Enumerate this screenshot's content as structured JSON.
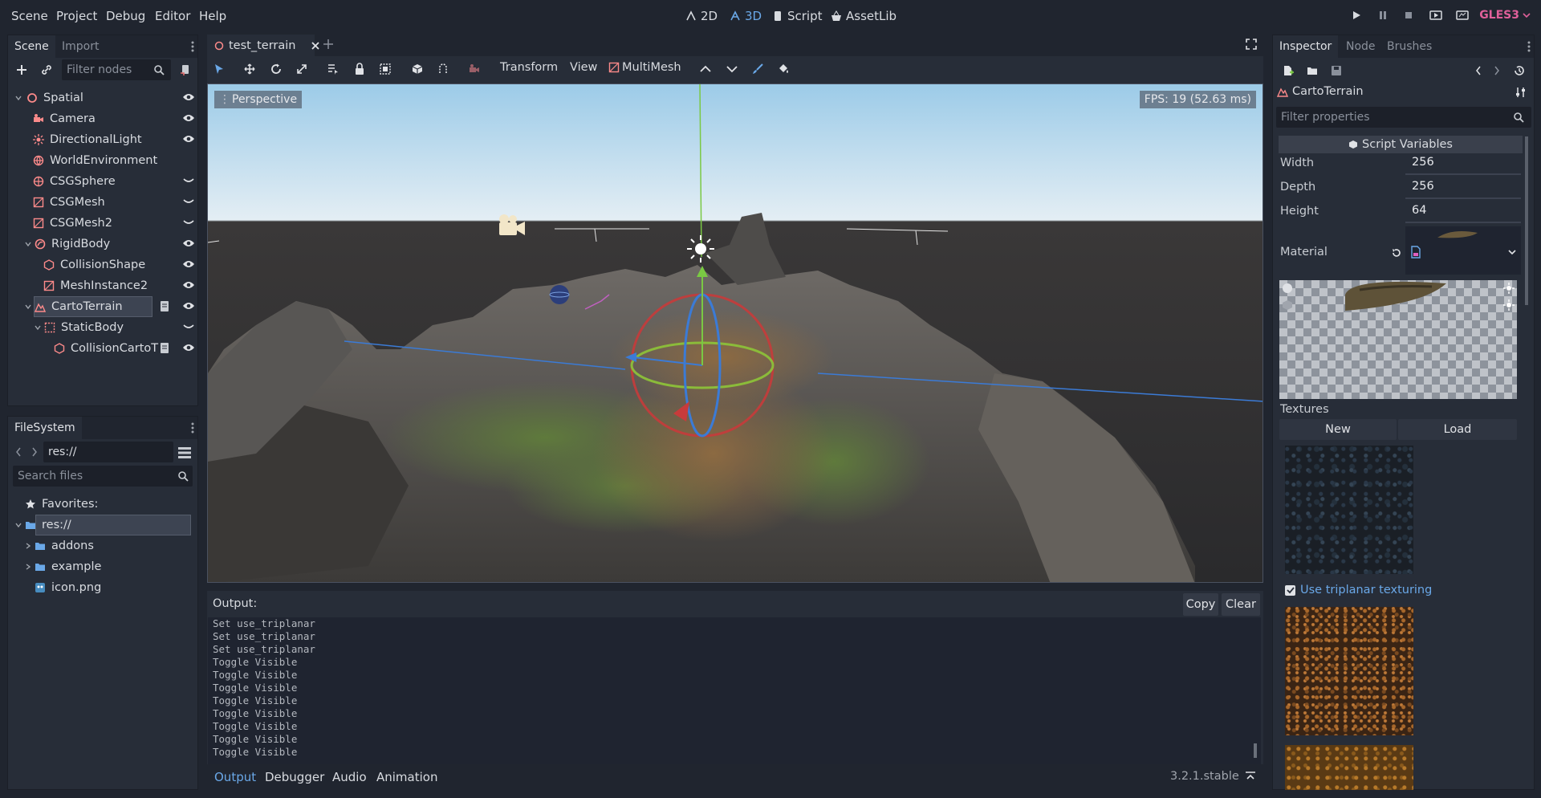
{
  "menu": [
    "Scene",
    "Project",
    "Debug",
    "Editor",
    "Help"
  ],
  "modes": {
    "m2d": "2D",
    "m3d": "3D",
    "script": "Script",
    "assetlib": "AssetLib"
  },
  "renderer": "GLES3",
  "scene_dock": {
    "tabs": {
      "scene": "Scene",
      "import": "Import"
    },
    "filter_placeholder": "Filter nodes",
    "nodes": [
      {
        "label": "Spatial"
      },
      {
        "label": "Camera"
      },
      {
        "label": "DirectionalLight"
      },
      {
        "label": "WorldEnvironment"
      },
      {
        "label": "CSGSphere"
      },
      {
        "label": "CSGMesh"
      },
      {
        "label": "CSGMesh2"
      },
      {
        "label": "RigidBody"
      },
      {
        "label": "CollisionShape"
      },
      {
        "label": "MeshInstance2"
      },
      {
        "label": "CartoTerrain"
      },
      {
        "label": "StaticBody"
      },
      {
        "label": "CollisionCartoT"
      }
    ]
  },
  "filesystem_dock": {
    "tab": "FileSystem",
    "path": "res://",
    "search_placeholder": "Search files",
    "items": [
      {
        "label": "Favorites:"
      },
      {
        "label": "res://"
      },
      {
        "label": "addons"
      },
      {
        "label": "example"
      },
      {
        "label": "icon.png"
      }
    ]
  },
  "editor_tab": "test_terrain",
  "toolbar": {
    "transform": "Transform",
    "view": "View",
    "multimesh": "MultiMesh"
  },
  "viewport": {
    "perspective": "Perspective",
    "fps": "FPS: 19 (52.63 ms)"
  },
  "output": {
    "title": "Output:",
    "copy": "Copy",
    "clear": "Clear",
    "lines": [
      "Set use_triplanar",
      "Set use_triplanar",
      "Set use_triplanar",
      "Toggle Visible",
      "Toggle Visible",
      "Toggle Visible",
      "Toggle Visible",
      "Toggle Visible",
      "Toggle Visible",
      "Toggle Visible",
      "Toggle Visible"
    ]
  },
  "bottom_tabs": [
    "Output",
    "Debugger",
    "Audio",
    "Animation"
  ],
  "version": "3.2.1.stable",
  "inspector": {
    "tabs": {
      "inspector": "Inspector",
      "node": "Node",
      "brushes": "Brushes"
    },
    "object": "CartoTerrain",
    "filter_placeholder": "Filter properties",
    "section": "Script Variables",
    "width_label": "Width",
    "width": "256",
    "depth_label": "Depth",
    "depth": "256",
    "height_label": "Height",
    "height": "64",
    "material_label": "Material",
    "textures_label": "Textures",
    "new": "New",
    "load": "Load",
    "triplanar": "Use triplanar texturing"
  }
}
